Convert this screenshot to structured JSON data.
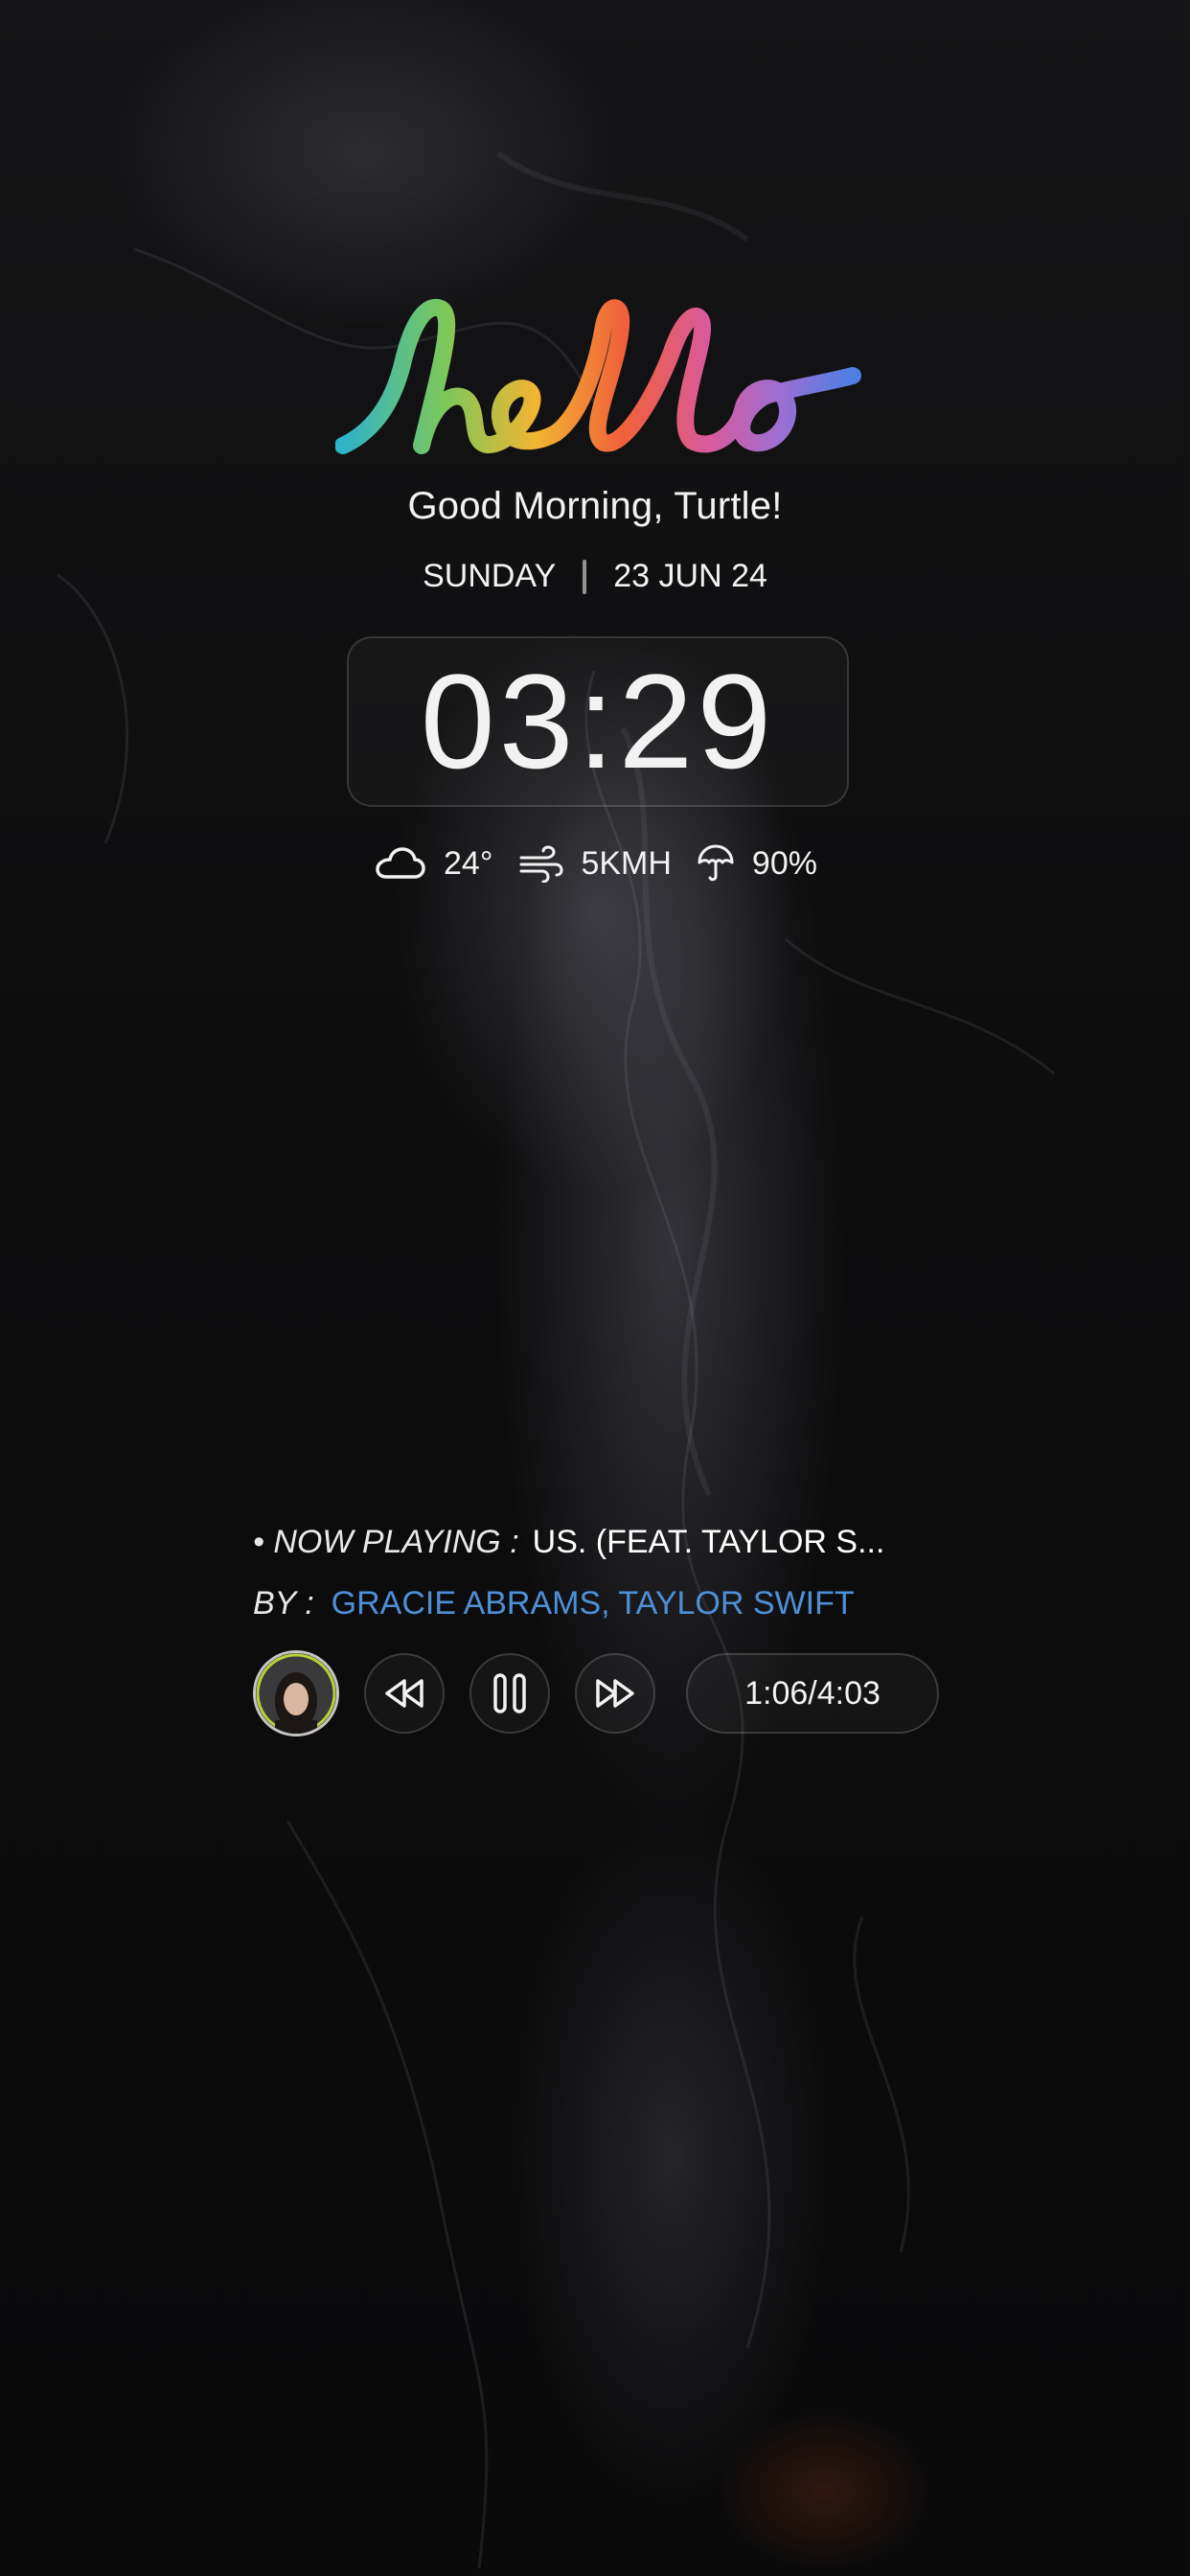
{
  "header": {
    "hello_text": "hello",
    "greeting": "Good Morning, Turtle!",
    "day": "SUNDAY",
    "date": "23 JUN 24"
  },
  "clock": {
    "time": "03:29"
  },
  "weather": {
    "temperature": "24°",
    "wind": "5KMH",
    "rain_chance": "90%",
    "icons": [
      "cloud-icon",
      "wind-icon",
      "umbrella-icon"
    ]
  },
  "now_playing": {
    "label": "• NOW PLAYING :",
    "title": "US. (FEAT. TAYLOR S...",
    "by_label": "BY :",
    "artist": "GRACIE ABRAMS, TAYLOR SWIFT",
    "progress_text": "1:06/4:03",
    "artist_color": "#4f8fd6",
    "controls": [
      "rewind-icon",
      "pause-icon",
      "fast-forward-icon"
    ]
  }
}
